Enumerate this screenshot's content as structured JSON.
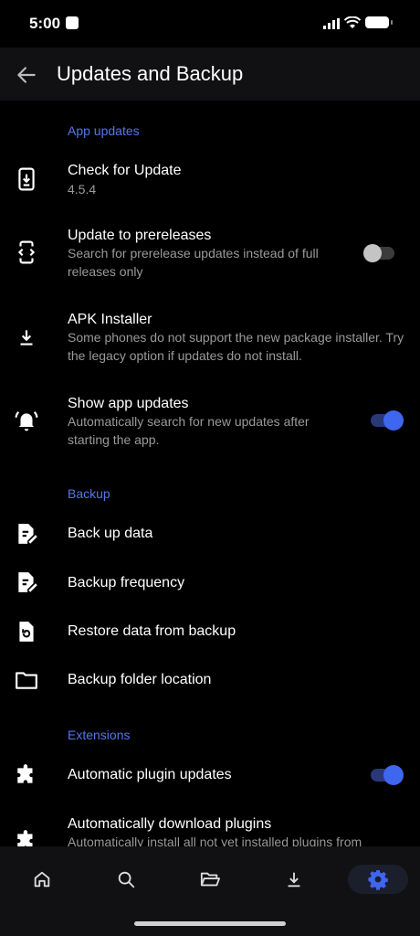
{
  "status": {
    "time": "5:00"
  },
  "header": {
    "title": "Updates and Backup"
  },
  "sections": {
    "app_updates": "App updates",
    "backup": "Backup",
    "extensions": "Extensions"
  },
  "rows": {
    "check_update": {
      "title": "Check for Update",
      "subtitle": "4.5.4"
    },
    "prereleases": {
      "title": "Update to prereleases",
      "subtitle": "Search for prerelease updates instead of full releases only",
      "enabled": false
    },
    "apk_installer": {
      "title": "APK Installer",
      "subtitle": "Some phones do not support the new package installer. Try the legacy option if updates do not install."
    },
    "show_updates": {
      "title": "Show app updates",
      "subtitle": "Automatically search for new updates after starting the app.",
      "enabled": true
    },
    "back_up_data": {
      "title": "Back up data"
    },
    "backup_frequency": {
      "title": "Backup frequency"
    },
    "restore_data": {
      "title": "Restore data from backup"
    },
    "backup_folder": {
      "title": "Backup folder location"
    },
    "plugin_updates": {
      "title": "Automatic plugin updates",
      "enabled": true
    },
    "download_plugins": {
      "title": "Automatically download plugins",
      "subtitle": "Automatically install all not yet installed plugins from"
    }
  },
  "nav": {
    "active": "settings-icon"
  },
  "colors": {
    "accent": "#5476ee",
    "toggle_on": "#3f66ee",
    "background": "#000000",
    "bar": "#111113"
  }
}
